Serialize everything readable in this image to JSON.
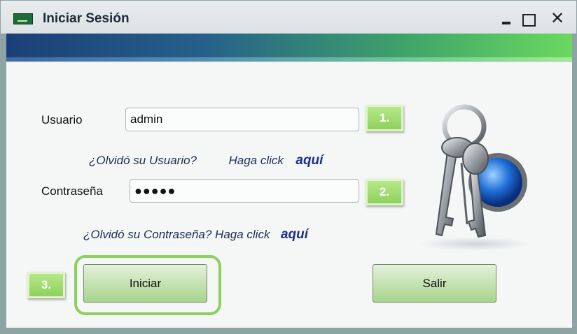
{
  "window": {
    "title": "Iniciar Sesión",
    "controls": {
      "minimize": "minimize-icon",
      "maximize": "maximize-icon",
      "close": "✕"
    }
  },
  "form": {
    "user_label": "Usuario",
    "user_value": "admin",
    "password_label": "Contraseña",
    "password_value": "●●●●●",
    "forgot_user_text": "¿Olvidó su Usuario?",
    "forgot_user_mid": "Haga click",
    "forgot_user_link": "aquí",
    "forgot_password_text": "¿Olvidó su Contraseña? Haga click",
    "forgot_password_link": "aquí"
  },
  "steps": [
    "1.",
    "2.",
    "3."
  ],
  "buttons": {
    "login": "Iniciar",
    "exit": "Salir"
  },
  "colors": {
    "accent_green": "#8dd05c",
    "link_blue": "#1d2e8a",
    "banner_start": "#1b3f78",
    "banner_end": "#6bd85f"
  },
  "decoration": {
    "illustration": "keys-icon"
  }
}
